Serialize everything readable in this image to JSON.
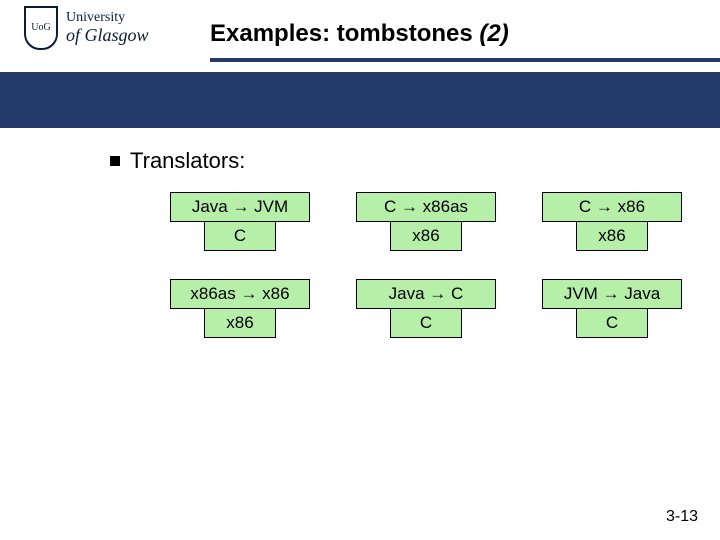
{
  "logo": {
    "line1": "University",
    "line2": "of Glasgow",
    "shield": "UoG"
  },
  "title": {
    "main": "Examples: tombstones ",
    "ital": "(2)"
  },
  "bullet": "Translators:",
  "tombstones": [
    [
      {
        "top": "Java → JVM",
        "stem": "C"
      },
      {
        "top": "C  →  x86as",
        "stem": "x86"
      },
      {
        "top": "C  →  x86",
        "stem": "x86"
      }
    ],
    [
      {
        "top": "x86as → x86",
        "stem": "x86"
      },
      {
        "top": "Java  →  C",
        "stem": "C"
      },
      {
        "top": "JVM → Java",
        "stem": "C"
      }
    ]
  ],
  "pagenum": "3-13"
}
